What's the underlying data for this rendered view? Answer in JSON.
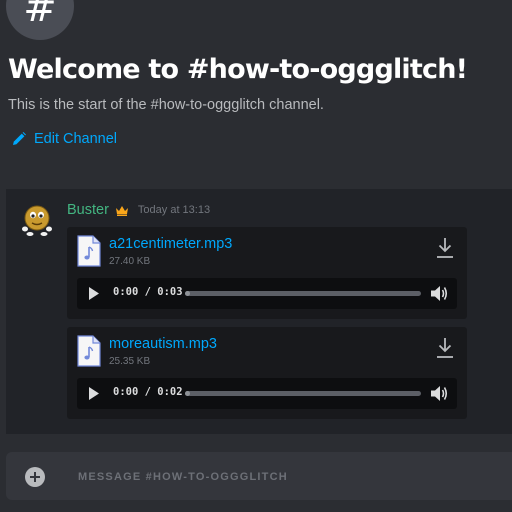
{
  "channel": {
    "hash_symbol": "#",
    "welcome_title": "Welcome to #how-to-oggglitch!",
    "start_text": "This is the start of the #how-to-oggglitch channel.",
    "edit_label": "Edit Channel"
  },
  "message": {
    "author": "Buster",
    "timestamp": "Today at 13:13",
    "attachments": [
      {
        "file_name": "a21centimeter.mp3",
        "file_size": "27.40 KB",
        "time": "0:00 / 0:03",
        "progress": 0
      },
      {
        "file_name": "moreautism.mp3",
        "file_size": "25.35 KB",
        "time": "0:00 / 0:02",
        "progress": 0
      }
    ]
  },
  "composer": {
    "placeholder": "MESSAGE #HOW-TO-OGGGLITCH"
  },
  "colors": {
    "accent_link": "#00a8fc",
    "author_green": "#43b581",
    "crown_gold": "#faa61a"
  },
  "icons": {
    "edit": "pencil-icon",
    "file": "audio-file-icon",
    "download": "download-icon",
    "play": "play-icon",
    "volume": "volume-icon",
    "add": "plus-circle-icon",
    "owner": "crown-icon"
  }
}
